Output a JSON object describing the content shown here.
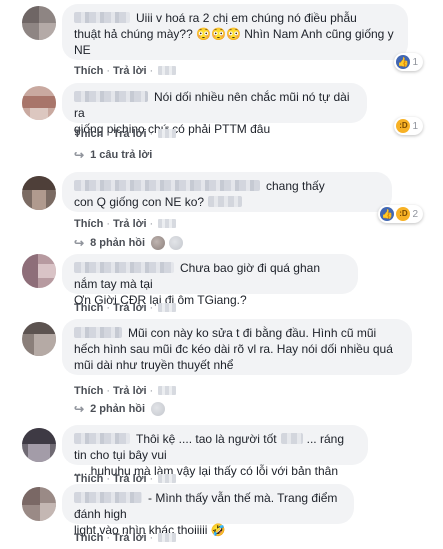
{
  "actions": {
    "like": "Thích",
    "reply": "Trả lời",
    "separator": "·"
  },
  "comments": [
    {
      "text_line1": "Uiii v hoá ra 2 chị em chúng nó điều phẫu",
      "text_line2": "thuật hả chúng mày?? 😳😳😳 Nhìn Nam Anh cũng giống y",
      "text_line3": "NE",
      "reaction_count": "1",
      "reaction_types": [
        "like-icon"
      ]
    },
    {
      "text_line1": "Nói dối nhiều nên chắc mũi nó tự dài ra",
      "text_line2": "giống pichino chứ có phải PTTM đâu",
      "reaction_count": "1",
      "reaction_types": [
        "haha-icon"
      ],
      "replies_label": "1 câu trả lời"
    },
    {
      "text_line1": "chang thấy",
      "text_line2": "con Q giống con NE ko?",
      "reaction_count": "2",
      "reaction_types": [
        "like-icon",
        "haha-icon"
      ],
      "replies_label": "8 phản hồi"
    },
    {
      "text_line1": "Chưa bao giờ đi quá ghan nắm tay mà tại",
      "text_line2": "Ơn Giời CĐR lại đi ôm TGiang.?"
    },
    {
      "text_line1": "Mũi con này ko sửa t đi bằng đầu. Hình cũ mũi",
      "text_line2": "hếch hình sau mũi đc kéo dài rõ vl ra. Hay nói dối nhiều quá",
      "text_line3": "mũi dài như truyền thuyết nhể",
      "replies_label": "2 phản hồi"
    },
    {
      "text_line1": "Thôi kệ .... tao là người tốt",
      "text_line1b": "... ráng tin cho tụi bây vui",
      "text_line2": ".... huhuhu mà làm vậy lại thấy có lỗi với bản thân"
    },
    {
      "text_line1": "- Mình thấy vẫn thế mà. Trang điểm đánh high",
      "text_line2": "light vào nhìn khác thoiiiii 🤣"
    }
  ],
  "colors": {
    "bubble": "#f2f3f5",
    "link": "#4b4f56",
    "meta": "#90949c",
    "like_blue": "#4267b2",
    "haha_yellow": "#f7b125"
  }
}
